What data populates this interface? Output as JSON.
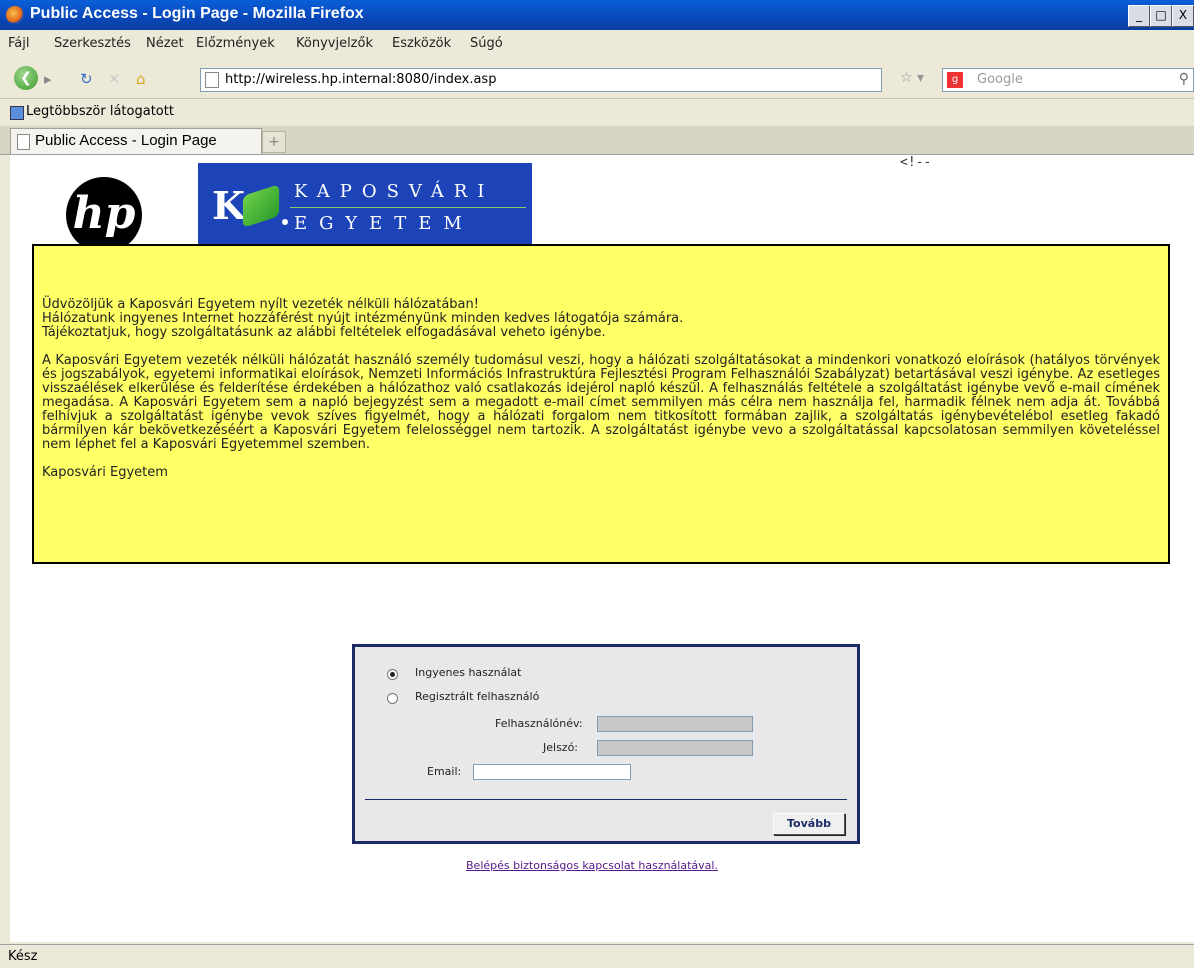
{
  "window": {
    "title": "Public Access - Login Page - Mozilla Firefox",
    "min": "_",
    "max": "□",
    "close": "X"
  },
  "menu": [
    "Fájl",
    "Szerkesztés",
    "Nézet",
    "Előzmények",
    "Könyvjelzők",
    "Eszközök",
    "Súgó"
  ],
  "nav": {
    "url": "http://wireless.hp.internal:8080/index.asp",
    "search_placeholder": "Google"
  },
  "bookmarks": {
    "item": "Legtöbbször látogatott"
  },
  "tab": {
    "label": "Public Access - Login Page",
    "new_tab": "+"
  },
  "page": {
    "comment": "<!--",
    "logo_hp": "hp",
    "logo_ke_letter": "K",
    "logo_ke_line1": "KAPOSVÁRI",
    "logo_ke_line2": "EGYETEM",
    "notice": {
      "p1_l1": "Üdvözöljük a Kaposvári Egyetem nyílt vezeték nélküli hálózatában!",
      "p1_l2": "Hálózatunk ingyenes Internet hozzáférést nyújt intézményünk minden kedves látogatója számára.",
      "p1_l3": "Tájékoztatjuk, hogy szolgáltatásunk az alábbi feltételek elfogadásával veheto igénybe.",
      "p2": "A Kaposvári Egyetem vezeték nélküli hálózatát használó személy tudomásul veszi, hogy a hálózati szolgáltatásokat a mindenkori vonatkozó eloírások (hatályos törvények és jogszabályok, egyetemi informatikai eloírások, Nemzeti Információs Infrastruktúra Fejlesztési Program Felhasználói Szabályzat) betartásával veszi igénybe. Az esetleges visszaélések elkerülése és felderítése érdekében a hálózathoz való csatlakozás idejérol napló készül. A felhasználás feltétele a szolgáltatást igénybe vevő e-mail címének megadása. A Kaposvári Egyetem sem a napló bejegyzést sem a megadott e-mail címet semmilyen más célra nem használja fel, harmadik félnek nem adja át. Továbbá felhívjuk a szolgáltatást igénybe vevok szíves figyelmét, hogy a hálózati forgalom nem titkosított formában zajlik, a szolgáltatás igénybevételébol esetleg fakadó bármilyen kár bekövetkezéséért a Kaposvári Egyetem felelosséggel nem tartozik. A szolgáltatást igénybe vevo a szolgáltatással kapcsolatosan semmilyen követeléssel nem léphet fel a Kaposvári Egyetemmel szemben.",
      "signature": "Kaposvári Egyetem"
    },
    "login": {
      "option_free": "Ingyenes használat",
      "option_registered": "Regisztrált felhasználó",
      "username_label": "Felhasználónév:",
      "password_label": "Jelszó:",
      "email_label": "Email:",
      "username_value": "",
      "password_value": "",
      "email_value": "",
      "selected_option": "Ingyenes használat",
      "submit": "Tovább"
    },
    "secure_link": "Belépés biztonságos kapcsolat használatával."
  },
  "status": "Kész"
}
